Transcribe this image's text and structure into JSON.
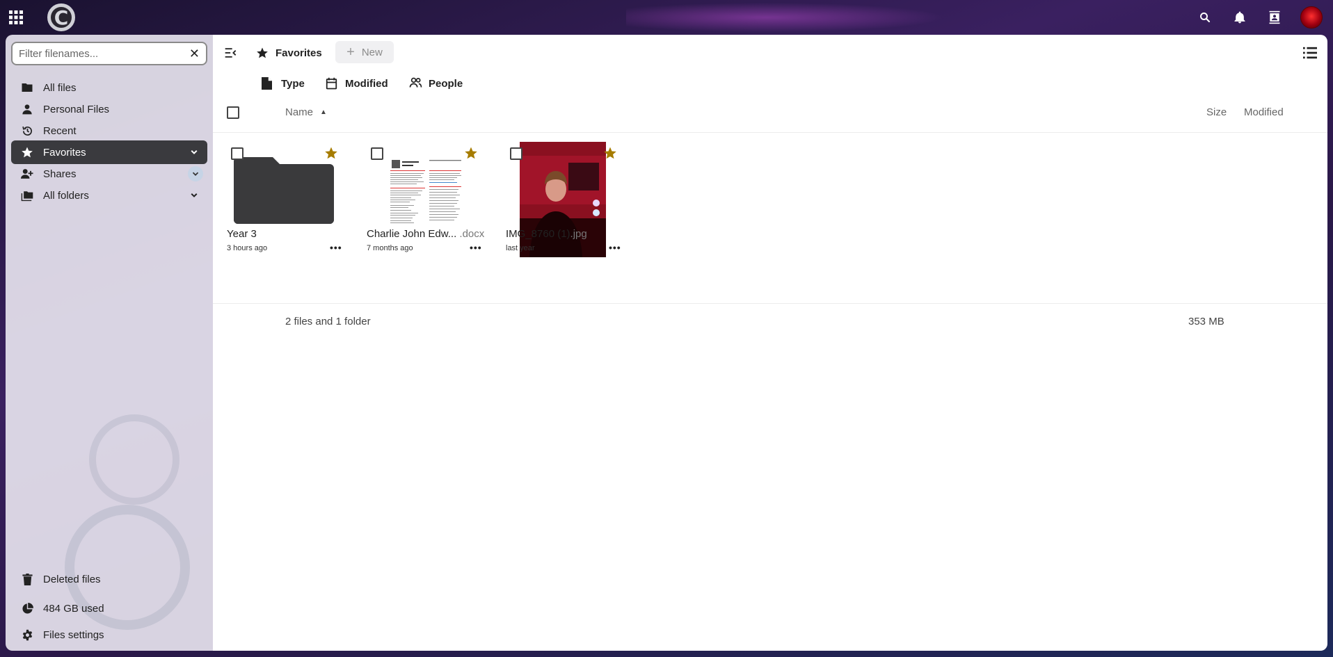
{
  "topbar": {
    "apps_icon": "apps-grid-icon",
    "logo_letter": "C",
    "icons": [
      "search-icon",
      "bell-icon",
      "contacts-icon",
      "avatar"
    ]
  },
  "sidebar": {
    "filter_placeholder": "Filter filenames...",
    "items": [
      {
        "label": "All files",
        "icon": "folder-icon"
      },
      {
        "label": "Personal Files",
        "icon": "person-icon"
      },
      {
        "label": "Recent",
        "icon": "history-icon"
      },
      {
        "label": "Favorites",
        "icon": "star-icon",
        "active": true
      },
      {
        "label": "Shares",
        "icon": "share-icon"
      },
      {
        "label": "All folders",
        "icon": "folders-icon"
      }
    ],
    "footer": [
      {
        "label": "Deleted files",
        "icon": "trash-icon"
      },
      {
        "label": "484 GB used",
        "icon": "pie-chart-icon"
      },
      {
        "label": "Files settings",
        "icon": "gear-icon"
      }
    ]
  },
  "main": {
    "breadcrumb": "Favorites",
    "new_label": "New",
    "filters": [
      "Type",
      "Modified",
      "People"
    ],
    "columns": {
      "name": "Name",
      "size": "Size",
      "modified": "Modified"
    },
    "files": [
      {
        "name": "Year 3",
        "ext": "",
        "modified": "3 hours ago",
        "kind": "folder"
      },
      {
        "name": "Charlie John Edw...",
        "ext": " .docx",
        "modified": "7 months ago",
        "kind": "document"
      },
      {
        "name": "IMG_8760 (1)",
        "ext": ".jpg",
        "modified": "last year",
        "kind": "image"
      }
    ],
    "summary": "2 files and 1 folder",
    "total_size": "353 MB",
    "accent_star": "#a67c00",
    "active_nav_bg": "#3a3a3e"
  }
}
